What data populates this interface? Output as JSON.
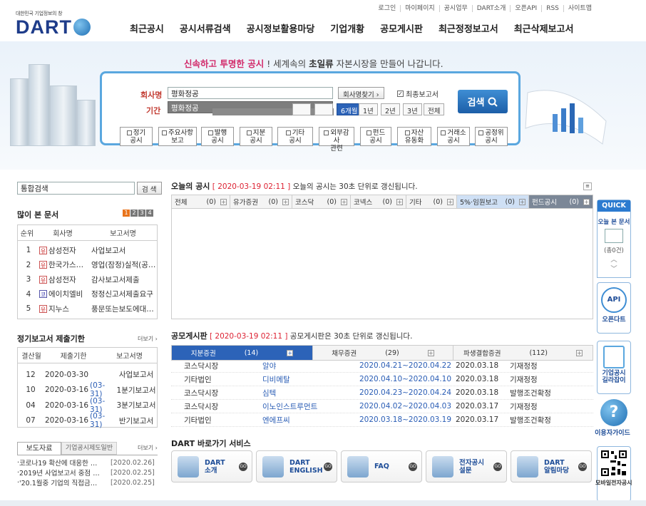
{
  "top_links": [
    "로그인",
    "마이페이지",
    "공시업무",
    "DART소개",
    "오픈API",
    "RSS",
    "사이트맵"
  ],
  "logo": {
    "tagline": "대한민국 기업정보의 창",
    "wordmark": "DART"
  },
  "gnb": [
    "최근공시",
    "공시서류검색",
    "공시정보활용마당",
    "기업개황",
    "공모게시판",
    "최근정정보고서",
    "최근삭제보고서"
  ],
  "slogan": {
    "p1": "신속하고 투명한 공시",
    "p2": " ! 세계속의 ",
    "p3": "초일류",
    "p4": " 자본시장을 만들어 나갑니다."
  },
  "search": {
    "company_label": "회사명",
    "company_value": "평화정공",
    "company_find": "회사명찾기 ›",
    "final_report": "최종보고서",
    "period_label": "기간",
    "autocomplete": "평화정공",
    "periods": [
      "6개월",
      "1년",
      "2년",
      "3년",
      "전체"
    ],
    "search_button": "검색",
    "categories": [
      "정기\n공시",
      "주요사항\n보고",
      "발행\n공시",
      "지분\n공시",
      "기타\n공시",
      "외부감사\n관련",
      "펀드\n공시",
      "자산\n유동화",
      "거래소\n공시",
      "공정위\n공시"
    ]
  },
  "integrated_search": {
    "value": "통합검색",
    "button": "검 색"
  },
  "most_viewed": {
    "title": "많이 본 문서",
    "pages": [
      "1",
      "2",
      "3",
      "4"
    ],
    "headers": [
      "순위",
      "회사명",
      "보고서명"
    ],
    "rows": [
      {
        "rank": "1",
        "badge": "유",
        "company": "삼성전자",
        "report": "사업보고서"
      },
      {
        "rank": "2",
        "badge": "유",
        "company": "한국가스…",
        "report": "영업(잠정)실적(공…"
      },
      {
        "rank": "3",
        "badge": "유",
        "company": "삼성전자",
        "report": "감사보고서제출"
      },
      {
        "rank": "4",
        "badge": "코",
        "company": "에이치엘비",
        "report": "정정신고서제출요구"
      },
      {
        "rank": "5",
        "badge": "유",
        "company": "지누스",
        "report": "풍문또는보도에대…"
      }
    ]
  },
  "deadline": {
    "title": "정기보고서 제출기한",
    "more": "더보기 ›",
    "headers": [
      "결산월",
      "제출기한",
      "보고서명"
    ],
    "rows": [
      {
        "month": "12",
        "due": "2020-03-30",
        "ext": "",
        "report": "사업보고서"
      },
      {
        "month": "10",
        "due": "2020-03-16",
        "ext": "(03-31)",
        "report": "1분기보고서"
      },
      {
        "month": "04",
        "due": "2020-03-16",
        "ext": "(03-31)",
        "report": "3분기보고서"
      },
      {
        "month": "07",
        "due": "2020-03-16",
        "ext": "(03-31)",
        "report": "반기보고서"
      }
    ]
  },
  "press": {
    "tabs": [
      "보도자료",
      "기업공시제도일반"
    ],
    "more": "더보기 ›",
    "items": [
      {
        "title": "코로나19 확산에 대응한 …",
        "date": "[2020.02.26]"
      },
      {
        "title": "2019년 사업보고서 중점 …",
        "date": "[2020.02.25]"
      },
      {
        "title": "'20.1월중 기업의 직접금…",
        "date": "[2020.02.25]"
      }
    ]
  },
  "today": {
    "title": "오늘의 공시",
    "time": "[ 2020-03-19 02:11 ]",
    "note": "오늘의 공시는 30초 단위로 갱신됩니다.",
    "tabs": [
      {
        "label": "전체",
        "count": "(0)"
      },
      {
        "label": "유가증권",
        "count": "(0)"
      },
      {
        "label": "코스닥",
        "count": "(0)"
      },
      {
        "label": "코넥스",
        "count": "(0)"
      },
      {
        "label": "기타",
        "count": "(0)"
      },
      {
        "label": "5%·임원보고",
        "count": "(0)"
      },
      {
        "label": "펀드공시",
        "count": "(0)"
      }
    ]
  },
  "offering": {
    "title": "공모게시판",
    "time": "[ 2020-03-19 02:11 ]",
    "note": "공모게시판은 30초 단위로 갱신됩니다.",
    "tabs": [
      {
        "label": "지분증권",
        "count": "(14)"
      },
      {
        "label": "채무증권",
        "count": "(29)"
      },
      {
        "label": "파생결합증권",
        "count": "(112)"
      }
    ],
    "rows": [
      {
        "market": "코스닥시장",
        "name": "알야",
        "period": "2020.04.21~2020.04.22",
        "date": "2020.03.18",
        "type": "기재정정"
      },
      {
        "market": "기타법인",
        "name": "디비메탈",
        "period": "2020.04.10~2020.04.10",
        "date": "2020.03.18",
        "type": "기재정정"
      },
      {
        "market": "코스닥시장",
        "name": "심텍",
        "period": "2020.04.23~2020.04.24",
        "date": "2020.03.18",
        "type": "발행조건확정"
      },
      {
        "market": "코스닥시장",
        "name": "이노인스트루먼트",
        "period": "2020.04.02~2020.04.03",
        "date": "2020.03.17",
        "type": "기재정정"
      },
      {
        "market": "기타법인",
        "name": "엔에프씨",
        "period": "2020.03.18~2020.03.19",
        "date": "2020.03.17",
        "type": "발행조건확정"
      }
    ]
  },
  "shortcuts": {
    "title": "DART 바로가기 서비스",
    "items": [
      {
        "l1": "DART",
        "l2": "소개"
      },
      {
        "l1": "DART",
        "l2": "ENGLISH"
      },
      {
        "l1": "FAQ",
        "l2": ""
      },
      {
        "l1": "전자공시",
        "l2": "설문"
      },
      {
        "l1": "DART",
        "l2": "알림마당"
      }
    ],
    "go": "GO"
  },
  "quick": {
    "title": "QUICK",
    "today_doc": "오늘 본 문서",
    "count": "(총0건)",
    "api": "API",
    "opendart": "오픈다트",
    "guide1": "기업공시",
    "guide2": "길라잡이",
    "help": "이용자가이드",
    "mobile": "모바일전자공시"
  }
}
